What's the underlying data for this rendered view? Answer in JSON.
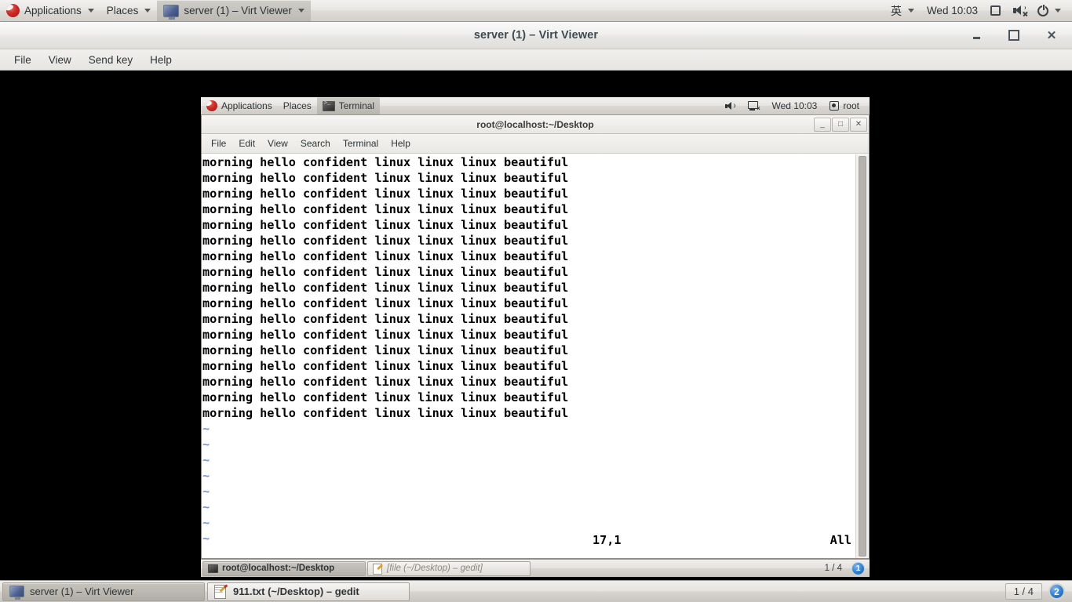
{
  "host_panel": {
    "applications": "Applications",
    "places": "Places",
    "active_window": "server (1) – Virt Viewer",
    "lang": "英",
    "clock": "Wed 10:03"
  },
  "virt_viewer": {
    "title": "server (1) – Virt Viewer",
    "menus": [
      "File",
      "View",
      "Send key",
      "Help"
    ],
    "window_buttons": {
      "minimize": "_",
      "maximize": "□",
      "close": "✕"
    }
  },
  "guest_panel": {
    "applications": "Applications",
    "places": "Places",
    "active_window": "Terminal",
    "clock": "Wed 10:03",
    "user": "root"
  },
  "terminal": {
    "title": "root@localhost:~/Desktop",
    "menus": [
      "File",
      "Edit",
      "View",
      "Search",
      "Terminal",
      "Help"
    ],
    "window_buttons": {
      "minimize": "_",
      "maximize": "□",
      "close": "✕"
    },
    "content_line": "morning hello confident linux linux linux beautiful",
    "content_line_count": 17,
    "tilde_marker": "~",
    "tilde_count": 8,
    "status_position": "17,1",
    "status_scroll": "All"
  },
  "guest_taskbar": {
    "tasks": [
      {
        "label": "root@localhost:~/Desktop",
        "icon": "terminal-icon",
        "state": "active"
      },
      {
        "label": "[file (~/Desktop) – gedit]",
        "icon": "gedit-icon",
        "state": "minimized"
      }
    ],
    "workspace_pages": "1 / 4",
    "workspace_current": "1"
  },
  "host_taskbar": {
    "tasks": [
      {
        "label": "server (1) – Virt Viewer",
        "icon": "virt-viewer-icon",
        "state": "active"
      },
      {
        "label": "911.txt (~/Desktop) – gedit",
        "icon": "gedit-icon",
        "state": "normal"
      }
    ],
    "workspace_pages": "1 / 4",
    "workspace_current": "2"
  },
  "colors": {
    "panel_bg": "#e8e6e3",
    "accent_blue": "#2f7fd0",
    "vim_tilde": "#6f95d8",
    "terminal_bg": "#ffffff",
    "terminal_fg": "#000000"
  }
}
